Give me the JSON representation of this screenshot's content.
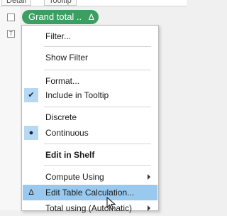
{
  "header": {
    "left_label": "Detail",
    "right_label": "Tooltip"
  },
  "pill": {
    "label": "Grand total ..",
    "delta": "Δ",
    "color": "#3e9e62"
  },
  "menu": {
    "items": [
      {
        "label": "Filter..."
      },
      {
        "label": "Show Filter"
      },
      {
        "label": "Format..."
      },
      {
        "label": "Include in Tooltip",
        "checked": true
      },
      {
        "label": "Discrete"
      },
      {
        "label": "Continuous",
        "selected": true
      },
      {
        "label": "Edit in Shelf"
      },
      {
        "label": "Compute Using"
      },
      {
        "label": "Edit Table Calculation...",
        "highlighted": true,
        "marker": "Δ"
      },
      {
        "label": "Total using (Automatic)"
      }
    ]
  },
  "colors": {
    "highlight": "#99c9ef",
    "check_bg": "#b7d8f3"
  }
}
